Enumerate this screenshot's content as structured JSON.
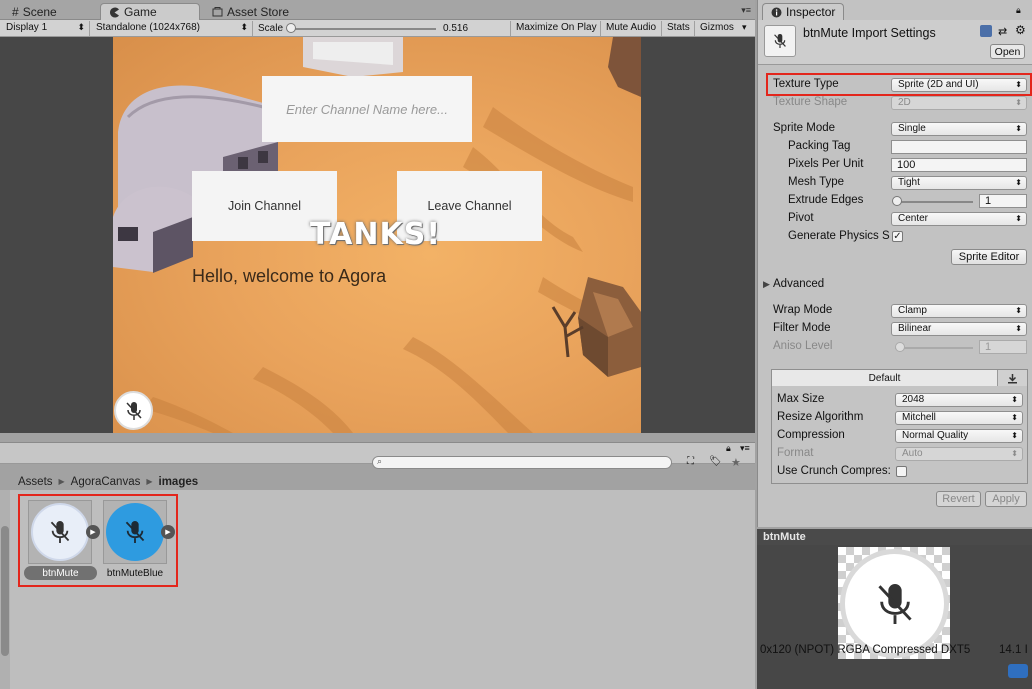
{
  "tabs": {
    "scene": "Scene",
    "game": "Game",
    "asset_store": "Asset Store",
    "inspector": "Inspector"
  },
  "game_toolbar": {
    "display": "Display 1",
    "resolution": "Standalone (1024x768)",
    "scale_label": "Scale",
    "scale_value": "0.516",
    "maximize": "Maximize On Play",
    "mute_audio": "Mute Audio",
    "stats": "Stats",
    "gizmos": "Gizmos"
  },
  "game": {
    "channel_placeholder": "Enter Channel Name here...",
    "join_button": "Join Channel",
    "leave_button": "Leave Channel",
    "logo_text": "TANKS!",
    "welcome": "Hello, welcome to Agora"
  },
  "project": {
    "breadcrumb": [
      "Assets",
      "AgoraCanvas",
      "images"
    ],
    "assets": [
      {
        "name": "btnMute",
        "color": "#e8eef8"
      },
      {
        "name": "btnMuteBlue",
        "color": "#2e9be0"
      }
    ]
  },
  "inspector": {
    "title": "btnMute Import Settings",
    "open_button": "Open",
    "texture_type_label": "Texture Type",
    "texture_type": "Sprite (2D and UI)",
    "texture_shape_label": "Texture Shape",
    "texture_shape": "2D",
    "sprite_mode_label": "Sprite Mode",
    "sprite_mode": "Single",
    "packing_tag_label": "Packing Tag",
    "packing_tag": "",
    "ppu_label": "Pixels Per Unit",
    "ppu": "100",
    "mesh_type_label": "Mesh Type",
    "mesh_type": "Tight",
    "extrude_label": "Extrude Edges",
    "extrude": "1",
    "pivot_label": "Pivot",
    "pivot": "Center",
    "physics_label": "Generate Physics Sh",
    "physics_checked": "✓",
    "sprite_editor": "Sprite Editor",
    "advanced": "Advanced",
    "wrap_label": "Wrap Mode",
    "wrap": "Clamp",
    "filter_label": "Filter Mode",
    "filter": "Bilinear",
    "aniso_label": "Aniso Level",
    "aniso": "1",
    "platform_tab": "Default",
    "max_size_label": "Max Size",
    "max_size": "2048",
    "resize_label": "Resize Algorithm",
    "resize": "Mitchell",
    "compression_label": "Compression",
    "compression": "Normal Quality",
    "format_label": "Format",
    "format": "Auto",
    "crunch_label": "Use Crunch Compres:",
    "revert": "Revert",
    "apply": "Apply"
  },
  "preview": {
    "title": "btnMute",
    "info": "0x120 (NPOT)  RGBA Compressed DXT5",
    "size": "14.1 I"
  },
  "highlight_color": "#e3261c"
}
